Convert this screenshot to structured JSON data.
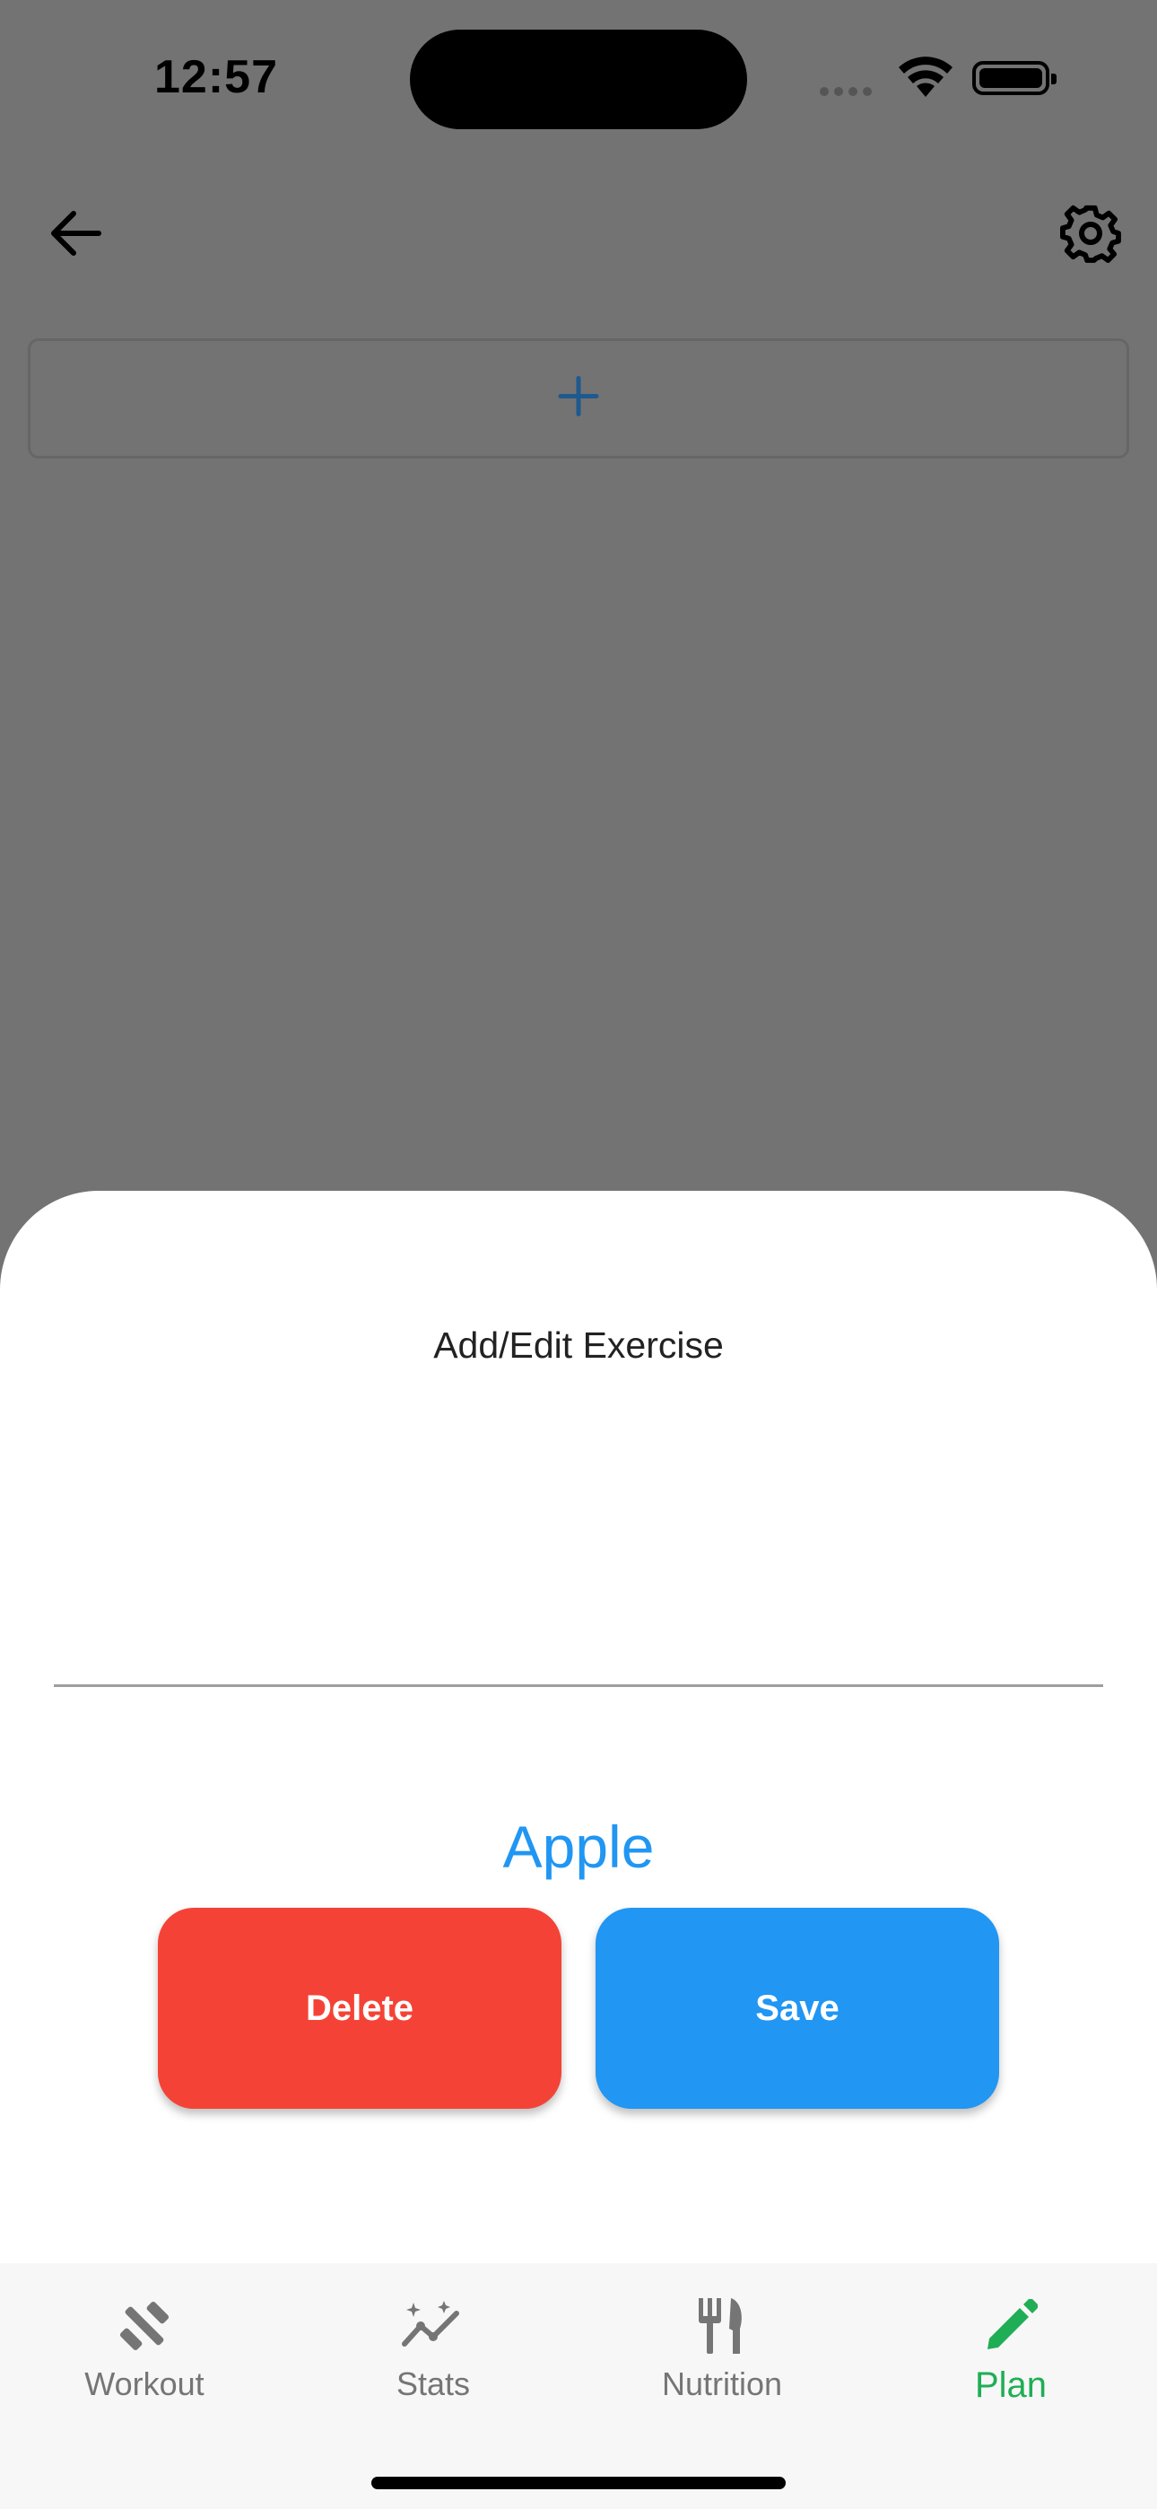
{
  "status_bar": {
    "time": "12:57"
  },
  "sheet": {
    "title": "Add/Edit Exercise",
    "name_value": "",
    "value_text": "Apple",
    "delete_label": "Delete",
    "save_label": "Save"
  },
  "nav": {
    "items": [
      {
        "label": "Workout",
        "icon": "dumbbell-icon"
      },
      {
        "label": "Stats",
        "icon": "stats-sparkle-icon"
      },
      {
        "label": "Nutrition",
        "icon": "fork-knife-icon"
      },
      {
        "label": "Plan",
        "icon": "pencil-icon",
        "active": true
      }
    ]
  },
  "colors": {
    "accent_blue": "#2196f3",
    "delete_red": "#f44336",
    "active_green": "#1fae55",
    "scrim": "#737373"
  }
}
